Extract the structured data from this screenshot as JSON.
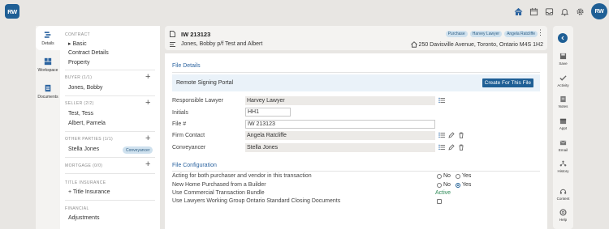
{
  "app": {
    "logo": "RW",
    "avatar_initials": "RW",
    "top_icons": [
      "home-icon",
      "calendar-icon",
      "inbox-icon",
      "bell-icon",
      "gear-icon"
    ]
  },
  "rail": {
    "items": [
      {
        "label": "Details",
        "icon": "details-icon"
      },
      {
        "label": "Workspace",
        "icon": "workspace-icon"
      },
      {
        "label": "Documents",
        "icon": "documents-icon"
      }
    ]
  },
  "nav": {
    "contract_header": "CONTRACT",
    "contract_items": [
      "Basic",
      "Contract Details",
      "Property"
    ],
    "buyer_header": "BUYER (1/1)",
    "buyer_items": [
      "Jones, Bobby"
    ],
    "seller_header": "SELLER (2/2)",
    "seller_items": [
      "Test, Tess",
      "Albert, Pamela"
    ],
    "other_header": "OTHER PARTIES (1/1)",
    "other_items": [
      "Stella Jones"
    ],
    "other_badge": "Conveyancer",
    "mortgage_header": "MORTGAGE (0/0)",
    "title_header": "TITLE INSURANCE",
    "title_items": [
      "+ Title Insurance"
    ],
    "financial_header": "FINANCIAL",
    "financial_items": [
      "Adjustments"
    ]
  },
  "header": {
    "file_number": "IW 213123",
    "parties": "Jones, Bobby p/f Test and Albert",
    "address": "250 Davisville Avenue, Toronto, Ontario M4S 1H2",
    "tags": [
      "Purchase",
      "Harvey Lawyer",
      "Angela Ratcliffe"
    ]
  },
  "file_details": {
    "title": "File Details",
    "remote_label": "Remote Signing Portal",
    "remote_button": "Create For This File",
    "fields": [
      {
        "label": "Responsible Lawyer",
        "value": "Harvey Lawyer"
      },
      {
        "label": "Initials",
        "value": "HH1"
      },
      {
        "label": "File #",
        "value": "IW 213123"
      },
      {
        "label": "Firm Contact",
        "value": "Angela Ratcliffe"
      },
      {
        "label": "Conveyancer",
        "value": "Stella Jones"
      }
    ]
  },
  "file_config": {
    "title": "File Configuration",
    "rows": [
      {
        "label": "Acting for both purchaser and vendor in this transaction",
        "no": "No",
        "yes": "Yes",
        "selected": "none"
      },
      {
        "label": "New Home Purchased from a Builder",
        "no": "No",
        "yes": "Yes",
        "selected": "yes"
      },
      {
        "label": "Use Commercial Transaction Bundle",
        "status": "Active"
      },
      {
        "label": "Use Lawyers Working Group Ontario Standard Closing Documents",
        "checked": false
      }
    ]
  },
  "right_rail": {
    "items": [
      {
        "label": "Save",
        "icon": "save-icon"
      },
      {
        "label": "Activity",
        "icon": "activity-icon"
      },
      {
        "label": "Notes",
        "icon": "notes-icon"
      },
      {
        "label": "Appt",
        "icon": "appointment-icon"
      },
      {
        "label": "Email",
        "icon": "email-icon"
      },
      {
        "label": "History",
        "icon": "history-icon"
      },
      {
        "label": "Content",
        "icon": "content-icon"
      },
      {
        "label": "Help",
        "icon": "help-icon"
      }
    ]
  },
  "colors": {
    "brand": "#1f5f95",
    "accent_text": "#2c64a0",
    "active": "#2e8b57",
    "tag_bg": "#cfe1ee"
  }
}
